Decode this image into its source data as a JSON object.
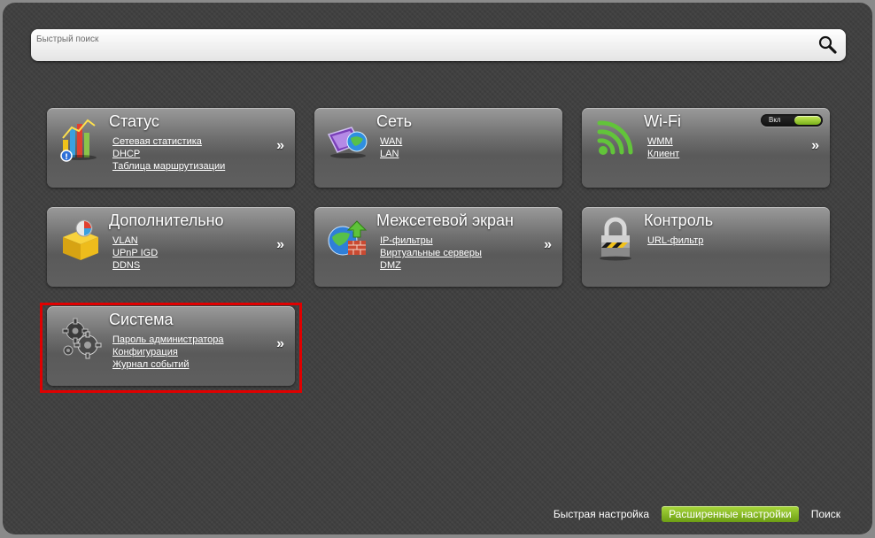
{
  "search": {
    "placeholder": "Быстрый поиск"
  },
  "tiles": [
    {
      "title": "Статус",
      "icon": "status-chart-icon",
      "links": [
        "Сетевая статистика",
        "DHCP",
        "Таблица маршрутизации"
      ],
      "arrow": "»"
    },
    {
      "title": "Сеть",
      "icon": "network-globe-icon",
      "links": [
        "WAN",
        "LAN"
      ],
      "arrow": "»"
    },
    {
      "title": "Wi-Fi",
      "icon": "wifi-icon",
      "links": [
        "WMM",
        "Клиент"
      ],
      "arrow": "»",
      "toggle": {
        "label": "Вкл",
        "state": "on"
      }
    },
    {
      "title": "Дополнительно",
      "icon": "advanced-box-icon",
      "links": [
        "VLAN",
        "UPnP IGD",
        "DDNS"
      ],
      "arrow": "»"
    },
    {
      "title": "Межсетевой экран",
      "icon": "firewall-icon",
      "links": [
        "IP-фильтры",
        "Виртуальные серверы",
        "DMZ"
      ],
      "arrow": "»"
    },
    {
      "title": "Контроль",
      "icon": "lock-icon",
      "links": [
        "URL-фильтр"
      ],
      "arrow": "»"
    },
    {
      "title": "Система",
      "icon": "gears-icon",
      "links": [
        "Пароль администратора",
        "Конфигурация",
        "Журнал событий"
      ],
      "arrow": "»"
    }
  ],
  "footer": {
    "quick_setup": "Быстрая настройка",
    "advanced_setup": "Расширенные настройки",
    "search": "Поиск"
  },
  "colors": {
    "background": "#3e3e3e",
    "tile": "#6e6e6e",
    "accent_green": "#8cc22a",
    "highlight": "#e00000"
  }
}
